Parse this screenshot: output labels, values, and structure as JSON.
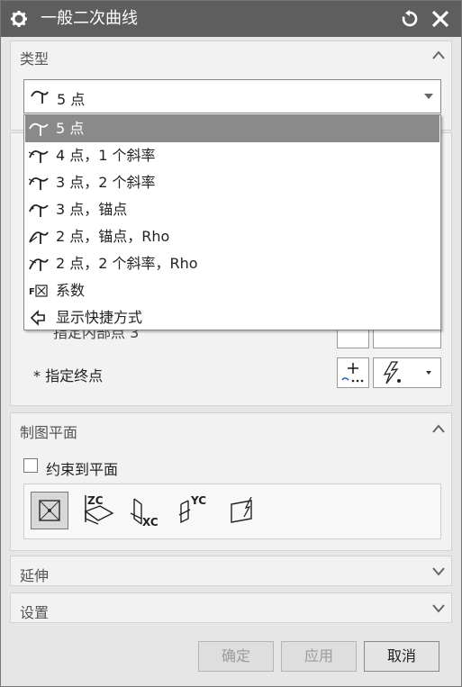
{
  "window": {
    "title": "一般二次曲线"
  },
  "type_section": {
    "header": "类型",
    "selected": "5 点",
    "options": [
      {
        "label": "5 点",
        "icon": "curve-5pt-icon"
      },
      {
        "label": "4 点，1 个斜率",
        "icon": "curve-4pt-slope-icon"
      },
      {
        "label": "3 点，2 个斜率",
        "icon": "curve-3pt-slope-icon"
      },
      {
        "label": "3 点，锚点",
        "icon": "curve-3pt-anchor-icon"
      },
      {
        "label": "2 点，锚点，Rho",
        "icon": "curve-2pt-anchor-rho-icon"
      },
      {
        "label": "2 点，2 个斜率，Rho",
        "icon": "curve-2pt-slope-rho-icon"
      },
      {
        "label": "系数",
        "icon": "coefficient-icon"
      },
      {
        "label": "显示快捷方式",
        "icon": "show-shortcuts-icon"
      }
    ]
  },
  "points_section": {
    "partial_row_label": "指定内部点 3",
    "end_point_label": "* 指定终点"
  },
  "drawing_plane": {
    "header": "制图平面",
    "constrain_label": "约束到平面",
    "plane_buttons": [
      "auto-plane-icon",
      "zc-plane-icon",
      "xc-plane-icon",
      "yc-plane-icon",
      "custom-plane-icon"
    ],
    "zc": "ZC",
    "xc": "XC",
    "yc": "YC"
  },
  "extend": {
    "header": "延伸"
  },
  "settings": {
    "header": "设置"
  },
  "footer": {
    "ok": "确定",
    "apply": "应用",
    "cancel": "取消"
  }
}
